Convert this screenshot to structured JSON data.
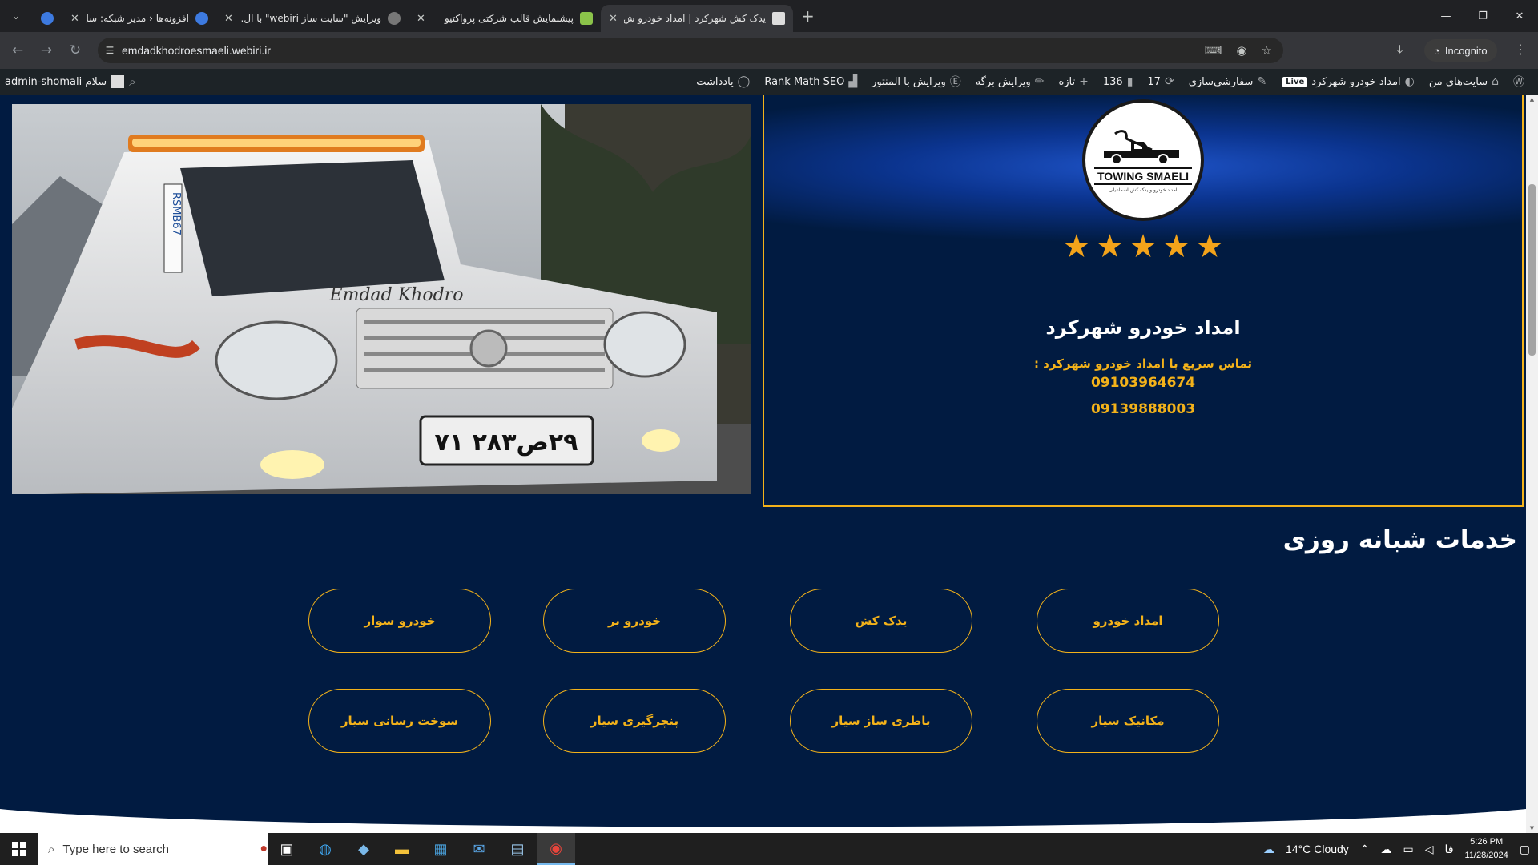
{
  "browser": {
    "tabs": [
      {
        "title": "",
        "active": false
      },
      {
        "title": "افزونه‌ها ‹ مدیر شبکه: سایت ساز",
        "active": false
      },
      {
        "title": "ویرایش \"سایت ساز webiri\" با ال...",
        "active": false
      },
      {
        "title": "پیشنمایش قالب شرکتی پرواکتیو",
        "active": false
      },
      {
        "title": "یدک کش شهرکرد | امداد خودرو ش",
        "active": true
      }
    ],
    "url": "emdadkhodroesmaeli.webiri.ir",
    "incognito_label": "Incognito"
  },
  "wp_admin_bar": {
    "my_sites": "سایت‌های من",
    "site_name": "امداد خودرو شهرکرد",
    "live_badge": "Live",
    "customize": "سفارشی‌سازی",
    "updates": "17",
    "comments": "136",
    "new": "تازه",
    "edit_page": "ویرایش برگه",
    "edit_elementor": "ویرایش با المنتور",
    "rank_math": "Rank Math SEO",
    "notes": "یادداشت",
    "greeting": "سلام admin-shomali"
  },
  "hero": {
    "plate_text": "۲۹ص۲۸۳ ۷۱",
    "grille_text": "Emdad Khodro",
    "door_text": "RSMB67"
  },
  "card": {
    "logo_text": "TOWING SMAELI",
    "logo_subtext": "امداد خودرو و یدک کش اسماعیلی",
    "rating": 5,
    "title": "امداد خودرو شهرکرد",
    "lead": "تماس سریع با امداد خودرو شهرکرد :",
    "phones": [
      "09103964674",
      "09139888003"
    ]
  },
  "services": {
    "title": "خدمات شبانه روزی",
    "items": [
      "امداد خودرو",
      "یدک کش",
      "خودرو بر",
      "خودرو سوار",
      "مکانیک سیار",
      "باطری ساز سیار",
      "پنچرگیری سیار",
      "سوخت رسانی سیار"
    ]
  },
  "taskbar": {
    "search_placeholder": "Type here to search",
    "weather": "14°C  Cloudy",
    "lang": "فا",
    "time": "5:26 PM",
    "date": "11/28/2024"
  },
  "colors": {
    "background": "#011b41",
    "accent": "#f3b21a",
    "star": "#f3a31a"
  },
  "icons": [
    "wordpress-icon",
    "sites-icon",
    "dashboard-icon",
    "brush-icon",
    "updates-icon",
    "comments-icon",
    "plus-icon",
    "pencil-icon",
    "elementor-icon",
    "rankmath-icon",
    "notes-icon",
    "search-icon",
    "star-icon"
  ]
}
